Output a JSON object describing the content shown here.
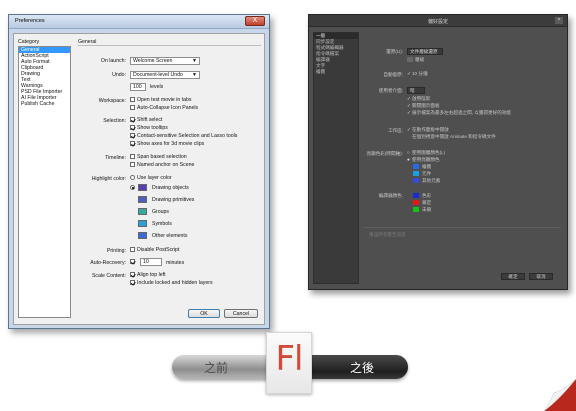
{
  "old_window": {
    "title": "Preferences",
    "close_glyph": "X",
    "category_label": "Category",
    "categories": [
      "General",
      "ActionScript",
      "Auto Format",
      "Clipboard",
      "Drawing",
      "Text",
      "Warnings",
      "PSD File Importer",
      "AI File Importer",
      "Publish Cache"
    ],
    "section_title": "General",
    "on_launch_label": "On launch:",
    "on_launch_value": "Welcome Screen",
    "undo_label": "Undo:",
    "undo_value": "Document-level Undo",
    "undo_levels_value": "100",
    "undo_levels_label": "levels",
    "workspace_label": "Workspace:",
    "workspace_opt1": "Open test movie in tabs",
    "workspace_opt2": "Auto-Collapse Icon Panels",
    "selection_label": "Selection:",
    "sel_opt1": "Shift select",
    "sel_opt2": "Show tooltips",
    "sel_opt3": "Contact-sensitive Selection and Lasso tools",
    "sel_opt4": "Show axes for 3d movie clips",
    "timeline_label": "Timeline:",
    "tl_opt1": "Span based selection",
    "tl_opt2": "Named anchor on Scene",
    "highlight_label": "Highlight color:",
    "use_layer_color": "Use layer color",
    "swatches": [
      {
        "label": "Drawing objects",
        "color": "#5a3fb0"
      },
      {
        "label": "Drawing primitives",
        "color": "#4a5fc0"
      },
      {
        "label": "Groups",
        "color": "#35a8a0"
      },
      {
        "label": "Symbols",
        "color": "#2aa0d8"
      },
      {
        "label": "Other elements",
        "color": "#3a6ad8"
      }
    ],
    "printing_label": "Printing:",
    "printing_opt": "Disable PostScript",
    "autorecovery_label": "Auto-Recovery:",
    "autorecovery_value": "10",
    "autorecovery_unit": "minutes",
    "scale_label": "Scale Content:",
    "scale_opt1": "Align top left",
    "scale_opt2": "Include locked and hidden layers",
    "ok_label": "OK",
    "cancel_label": "Cancel"
  },
  "new_window": {
    "title": "偏好設定",
    "close_glyph": "×",
    "categories": [
      "一般",
      "同步設定",
      "程式碼編輯器",
      "指令碼檔案",
      "編譯器",
      "文字",
      "繪圖"
    ],
    "row1_label": "還原(U):",
    "row1_value": "文件層級還原",
    "row1_sub": "層級",
    "row2_label": "自動復原:",
    "row2_value": "10 分鐘",
    "row3_label": "使用者介面:",
    "row3_value": "暗",
    "row3_opt1": "啟用陰影",
    "row3_opt2": "關閉圖示面板",
    "row3_opt3": "展示檔案為最多左右超過之間, 以獲得更好的效能",
    "workspace_label": "工作區:",
    "ws_opt1": "在動作面板中開啟",
    "ws_opt2": "在個別視窗中開啟 Animate 和指令碼文件",
    "highlight_label": "亮顯色彩(時間軸):",
    "hl_opt1": "使用圖層顏色(L)",
    "hl_opt2": "使用亮顯顏色",
    "hl_swatches": [
      {
        "label": "繪圖",
        "color": "#2a6ae0"
      },
      {
        "label": "元件",
        "color": "#1aa0e0"
      },
      {
        "label": "其他元素",
        "color": "#3a4ad8"
      }
    ],
    "grid_label": "編譯器顏色:",
    "grid_swatches": [
      {
        "label": "色彩",
        "color": "#1a2ad0"
      },
      {
        "label": "鎖定",
        "color": "#e01818"
      },
      {
        "label": "未鎖",
        "color": "#18c018"
      }
    ],
    "footer_text": "重設所有警告訊息",
    "ok_label": "確定",
    "cancel_label": "取消"
  },
  "compare_bar": {
    "before_label": "之前",
    "after_label": "之後",
    "logo_text": "Fl",
    "logo_color": "#d14a3a"
  }
}
